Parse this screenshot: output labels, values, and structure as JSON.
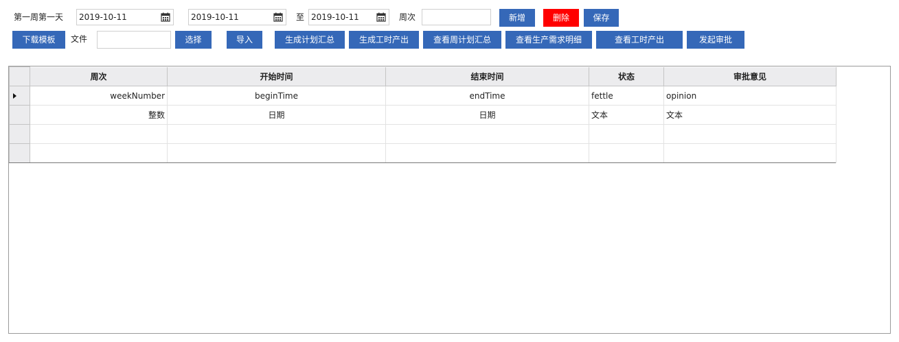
{
  "toolbar_row1": {
    "week_first_day_label": "第一周第一天",
    "week_first_day_value": "2019-10-11",
    "start_date_value": "2019-10-11",
    "to_label": "至",
    "end_date_value": "2019-10-11",
    "week_label": "周次",
    "week_value": "",
    "add_label": "新增",
    "delete_label": "删除",
    "save_label": "保存"
  },
  "toolbar_row2": {
    "download_template_label": "下载模板",
    "file_label": "文件",
    "file_value": "",
    "choose_label": "选择",
    "import_label": "导入",
    "gen_plan_summary_label": "生成计划汇总",
    "gen_hours_output_label": "生成工时产出",
    "view_week_plan_label": "查看周计划汇总",
    "view_production_demand_label": "查看生产需求明细",
    "view_hours_output_label": "查看工时产出",
    "start_approval_label": "发起审批"
  },
  "colors": {
    "button_blue": "#3568b8",
    "button_red": "#ff0000"
  },
  "grid": {
    "headers": [
      "周次",
      "开始时间",
      "结束时间",
      "状态",
      "审批意见"
    ],
    "rows": [
      [
        "weekNumber",
        "beginTime",
        "endTime",
        "fettle",
        "opinion"
      ],
      [
        "整数",
        "日期",
        "日期",
        "文本",
        "文本"
      ],
      [
        "",
        "",
        "",
        "",
        ""
      ],
      [
        "",
        "",
        "",
        "",
        ""
      ]
    ],
    "current_row_indicator": "triangle-right-icon"
  }
}
